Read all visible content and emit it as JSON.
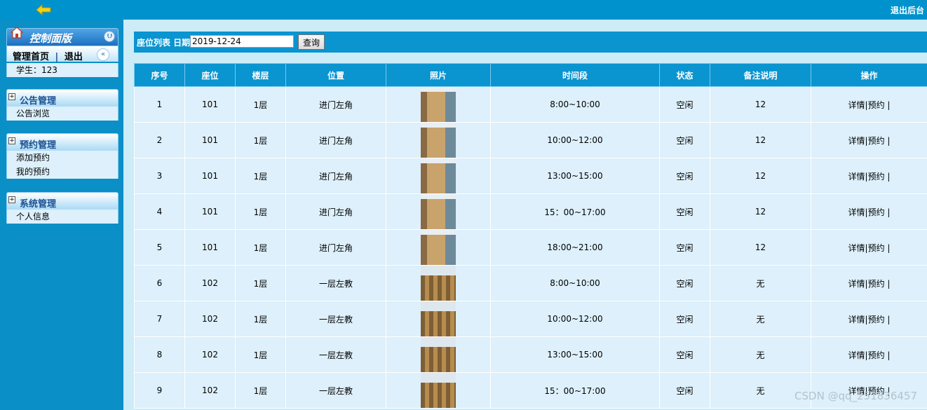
{
  "topbar": {
    "logout_label": "退出后台"
  },
  "sidebar": {
    "panel_title": "控制面版",
    "home_link": "管理首页",
    "separator": "|",
    "logout_link": "退出",
    "user_line": "学生：123",
    "sections": [
      {
        "title": "公告管理",
        "items": [
          "公告浏览"
        ]
      },
      {
        "title": "预约管理",
        "items": [
          "添加预约",
          "我的预约"
        ]
      },
      {
        "title": "系统管理",
        "items": [
          "个人信息"
        ]
      }
    ]
  },
  "toolbar": {
    "label": "座位列表 日期",
    "date_value": "2019-12-24",
    "query_label": "查询"
  },
  "table": {
    "headers": [
      "序号",
      "座位",
      "楼层",
      "位置",
      "照片",
      "时间段",
      "状态",
      "备注说明",
      "操作"
    ],
    "rows": [
      {
        "no": "1",
        "seat": "101",
        "floor": "1层",
        "location": "进门左角",
        "photo": "a",
        "time": "8:00~10:00",
        "status": "空闲",
        "note": "12",
        "ops": "详情|预约 |"
      },
      {
        "no": "2",
        "seat": "101",
        "floor": "1层",
        "location": "进门左角",
        "photo": "a",
        "time": "10:00~12:00",
        "status": "空闲",
        "note": "12",
        "ops": "详情|预约 |"
      },
      {
        "no": "3",
        "seat": "101",
        "floor": "1层",
        "location": "进门左角",
        "photo": "a",
        "time": "13:00~15:00",
        "status": "空闲",
        "note": "12",
        "ops": "详情|预约 |"
      },
      {
        "no": "4",
        "seat": "101",
        "floor": "1层",
        "location": "进门左角",
        "photo": "a",
        "time": "15：00~17:00",
        "status": "空闲",
        "note": "12",
        "ops": "详情|预约 |"
      },
      {
        "no": "5",
        "seat": "101",
        "floor": "1层",
        "location": "进门左角",
        "photo": "a",
        "time": "18:00~21:00",
        "status": "空闲",
        "note": "12",
        "ops": "详情|预约 |"
      },
      {
        "no": "6",
        "seat": "102",
        "floor": "1层",
        "location": "一层左教",
        "photo": "b",
        "time": "8:00~10:00",
        "status": "空闲",
        "note": "无",
        "ops": "详情|预约 |"
      },
      {
        "no": "7",
        "seat": "102",
        "floor": "1层",
        "location": "一层左教",
        "photo": "b",
        "time": "10:00~12:00",
        "status": "空闲",
        "note": "无",
        "ops": "详情|预约 |"
      },
      {
        "no": "8",
        "seat": "102",
        "floor": "1层",
        "location": "一层左教",
        "photo": "b",
        "time": "13:00~15:00",
        "status": "空闲",
        "note": "无",
        "ops": "详情|预约 |"
      },
      {
        "no": "9",
        "seat": "102",
        "floor": "1层",
        "location": "一层左教",
        "photo": "b",
        "time": "15：00~17:00",
        "status": "空闲",
        "note": "无",
        "ops": "详情|预约 |"
      }
    ]
  },
  "watermark": "CSDN @qq_251836457"
}
